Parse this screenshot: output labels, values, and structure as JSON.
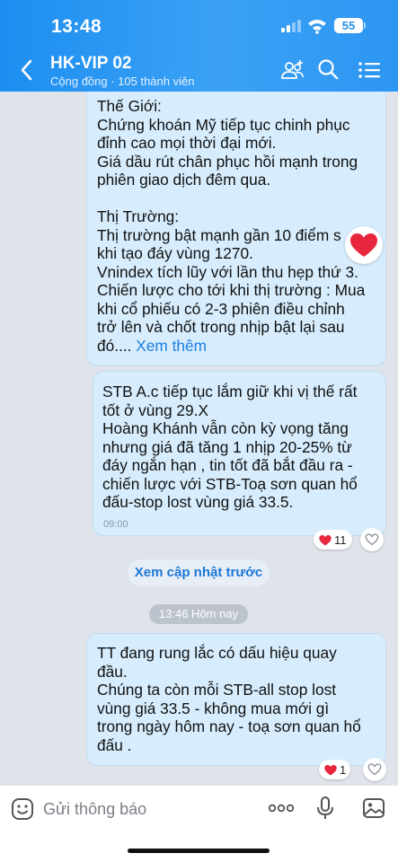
{
  "status_bar": {
    "time": "13:48",
    "battery": "55"
  },
  "header": {
    "title": "HK-VIP 02",
    "subtitle": "Cộng đồng · 105 thành viên"
  },
  "messages": [
    {
      "text": "Thế Giới:\nChứng khoán Mỹ tiếp tục chinh phục\nđỉnh cao mọi thời đại mới.\nGiá dầu rút chân phục hồi mạnh trong\nphiên giao dịch đêm qua.\n\nThị Trường:\nThị trường bật mạnh gần 10 điểm s\nkhi tạo đáy vùng 1270.\nVnindex tích lũy với lần thu hẹp thứ 3.\nChiến lược cho tới khi thị trường : Mua\nkhi cổ phiếu có 2-3 phiên điều chỉnh\ntrở lên và chốt trong nhịp bật lại sau\nđó....",
      "see_more": "Xem thêm"
    },
    {
      "text": "STB A.c tiếp tục lắm giữ khi vị thế rất\ntốt ở vùng 29.X\nHoàng Khánh vẫn còn kỳ vọng tăng\nnhưng  giá đã tăng 1 nhịp 20-25% từ\nđáy ngắn hạn , tin tốt đã bắt đầu ra -\nchiến lược với STB-Toạ sơn quan hổ\nđấu-stop lost vùng giá 33.5.",
      "time": "09:00",
      "reaction_count": "11"
    },
    {
      "text": "TT đang rung lắc có dấu hiệu quay\nđầu.\nChúng ta còn mỗi STB-all  stop lost\nvùng giá 33.5 - không mua mới gì\ntrong ngày hôm nay - toạ sơn quan hổ\nđấu .",
      "reaction_count": "1"
    }
  ],
  "load_previous": "Xem cập nhật trước",
  "time_divider": "13:46 Hôm nay",
  "input": {
    "placeholder": "Gửi thông báo"
  },
  "icons": {
    "back": "chevron-left-icon",
    "members": "members-icon",
    "search": "search-icon",
    "menu": "list-menu-icon",
    "reaction": "heart-icon",
    "like": "heart-outline-icon",
    "sticker": "sticker-icon",
    "more": "more-icon",
    "mic": "microphone-icon",
    "image": "image-icon"
  },
  "colors": {
    "header": "#2a96f2",
    "bubble": "#d7edfd",
    "link": "#1e7fe0",
    "heart": "#e8263d"
  }
}
